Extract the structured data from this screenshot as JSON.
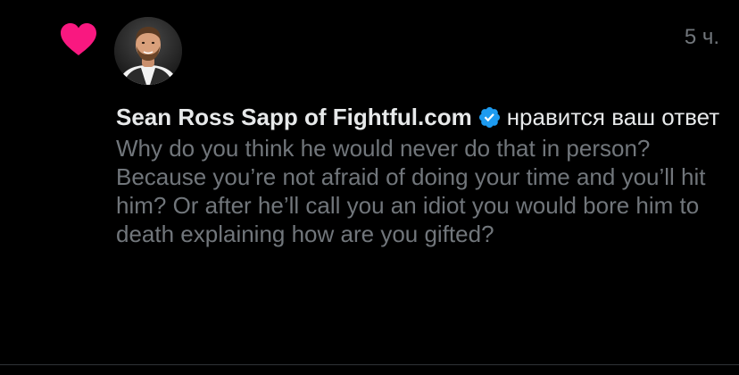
{
  "notification": {
    "type_icon": "heart-icon",
    "avatar_icon": "profile-photo",
    "time": "5 ч.",
    "author": "Sean Ross Sapp of Fightful.com",
    "verified_icon": "verified-badge-icon",
    "action_text": "нравится ваш ответ",
    "reply_text": "Why do you think he would never do that in person? Because you’re not afraid of doing your time and you’ll hit him? Or after he’ll call you an idiot you would bore him to death explaining how are you gifted?",
    "colors": {
      "background": "#000000",
      "heart": "#f91880",
      "verified": "#1d9bf0",
      "primary_text": "#e7e9ea",
      "secondary_text": "#71767b"
    }
  }
}
